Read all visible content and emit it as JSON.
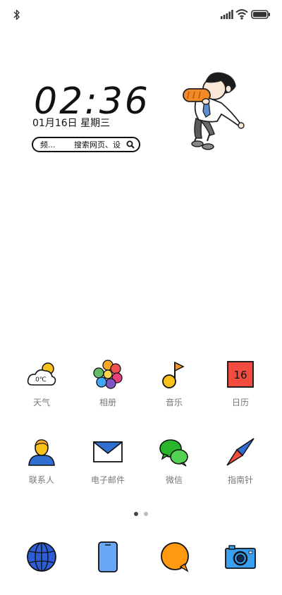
{
  "status_bar": {
    "icons": [
      "bluetooth-icon",
      "signal-icon",
      "wifi-icon",
      "battery-icon"
    ]
  },
  "clock_widget": {
    "time": "02:36",
    "date": "01月16日 星期三",
    "search_hint_left": "频...",
    "search_hint_right": "搜索网页、设"
  },
  "apps": [
    {
      "label": "天气",
      "icon": "weather-icon",
      "icon_text": "0℃"
    },
    {
      "label": "相册",
      "icon": "gallery-icon"
    },
    {
      "label": "音乐",
      "icon": "music-icon"
    },
    {
      "label": "日历",
      "icon": "calendar-icon",
      "icon_text": "16"
    },
    {
      "label": "联系人",
      "icon": "contacts-icon"
    },
    {
      "label": "电子邮件",
      "icon": "email-icon"
    },
    {
      "label": "微信",
      "icon": "wechat-icon"
    },
    {
      "label": "指南针",
      "icon": "compass-icon"
    }
  ],
  "page_indicator": {
    "current": 1,
    "total": 2
  },
  "dock": [
    {
      "icon": "browser-icon"
    },
    {
      "icon": "phone-icon"
    },
    {
      "icon": "messages-icon"
    },
    {
      "icon": "camera-icon"
    }
  ],
  "colors": {
    "background": "#ffffff",
    "label_gray": "#777777",
    "outline": "#111111",
    "calendar_red": "#f24b3f",
    "music_yellow": "#f9c21a",
    "email_blue": "#2f6fd1",
    "wechat_green": "#2bb52b",
    "browser_blue": "#2e5ed6",
    "phone_blue": "#6aa8f7",
    "messages_orange": "#ff9a10",
    "camera_blue": "#3aa0f0"
  }
}
